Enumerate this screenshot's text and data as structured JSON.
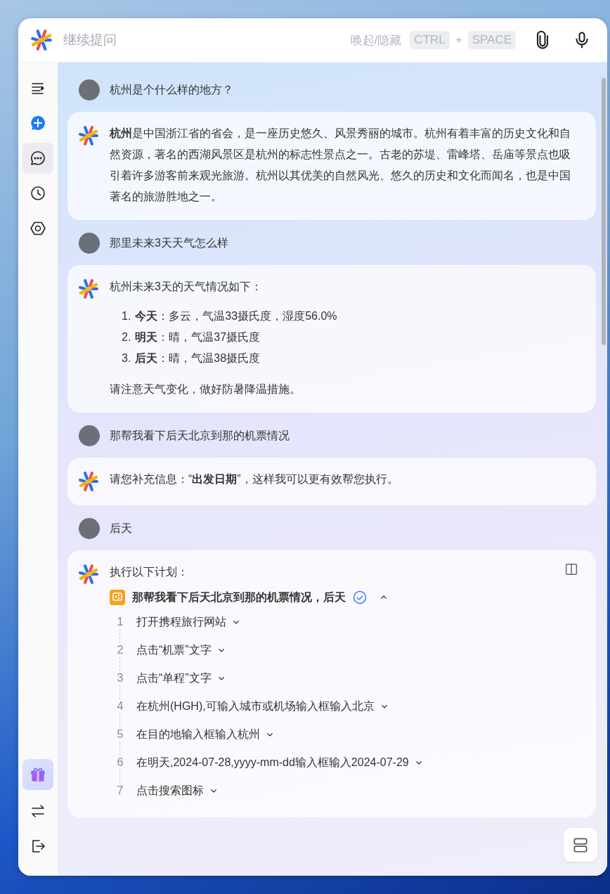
{
  "header": {
    "placeholder": "继续提问",
    "shortcut_hint": "唤起/隐藏",
    "keys": [
      "CTRL",
      "+",
      "SPACE"
    ]
  },
  "sidebar": {
    "items": [
      {
        "kind": "menu",
        "selected": false
      },
      {
        "kind": "new-chat",
        "selected": false
      },
      {
        "kind": "chat",
        "selected": true
      },
      {
        "kind": "history",
        "selected": false
      },
      {
        "kind": "settings",
        "selected": false
      }
    ],
    "bottom_items": [
      {
        "kind": "gift"
      },
      {
        "kind": "switch"
      },
      {
        "kind": "logout"
      }
    ]
  },
  "messages": [
    {
      "kind": "user",
      "text": "杭州是个什么样的地方？"
    },
    {
      "kind": "answer",
      "text": "**杭州**是中国浙江省的省会，是一座历史悠久、风景秀丽的城市。杭州有着丰富的历史文化和自然资源，著名的西湖风景区是杭州的标志性景点之一。古老的苏堤、雷峰塔、岳庙等景点也吸引着许多游客前来观光旅游。杭州以其优美的自然风光、悠久的历史和文化而闻名，也是中国著名的旅游胜地之一。"
    },
    {
      "kind": "user",
      "text": "那里未来3天天气怎么样"
    },
    {
      "kind": "list",
      "intro": "杭州未来3天的天气情况如下：",
      "items": [
        {
          "number": "1.",
          "text": "**今天**：多云，气温33摄氏度，湿度56.0%"
        },
        {
          "number": "2.",
          "text": "**明天**：晴，气温37摄氏度"
        },
        {
          "number": "3.",
          "text": "**后天**：晴，气温38摄氏度"
        }
      ],
      "outro": "请注意天气变化，做好防暑降温措施。"
    },
    {
      "kind": "user",
      "text": "那帮我看下后天北京到那的机票情况"
    },
    {
      "kind": "answer",
      "text": "请您补充信息：“**出发日期**”，这样我可以更有效帮您执行。"
    },
    {
      "kind": "user",
      "text": "后天"
    },
    {
      "kind": "plan",
      "intro": "执行以下计划：",
      "task": {
        "title": "那帮我看下后天北京到那的机票情况，后天",
        "done": true,
        "expanded": true
      },
      "steps": [
        {
          "number": "1",
          "text": "打开携程旅行网站",
          "expanded": false
        },
        {
          "number": "2",
          "text": "点击“机票”文字",
          "expanded": false
        },
        {
          "number": "3",
          "text": "点击“单程”文字",
          "expanded": false
        },
        {
          "number": "4",
          "text": "在杭州(HGH),可输入城市或机场输入框输入北京",
          "expanded": false
        },
        {
          "number": "5",
          "text": "在目的地输入框输入杭州",
          "expanded": false
        },
        {
          "number": "6",
          "text": "在明天,2024-07-28,yyyy-mm-dd输入框输入2024-07-29",
          "expanded": false
        },
        {
          "number": "7",
          "text": "点击搜索图标",
          "expanded": false
        }
      ]
    }
  ]
}
